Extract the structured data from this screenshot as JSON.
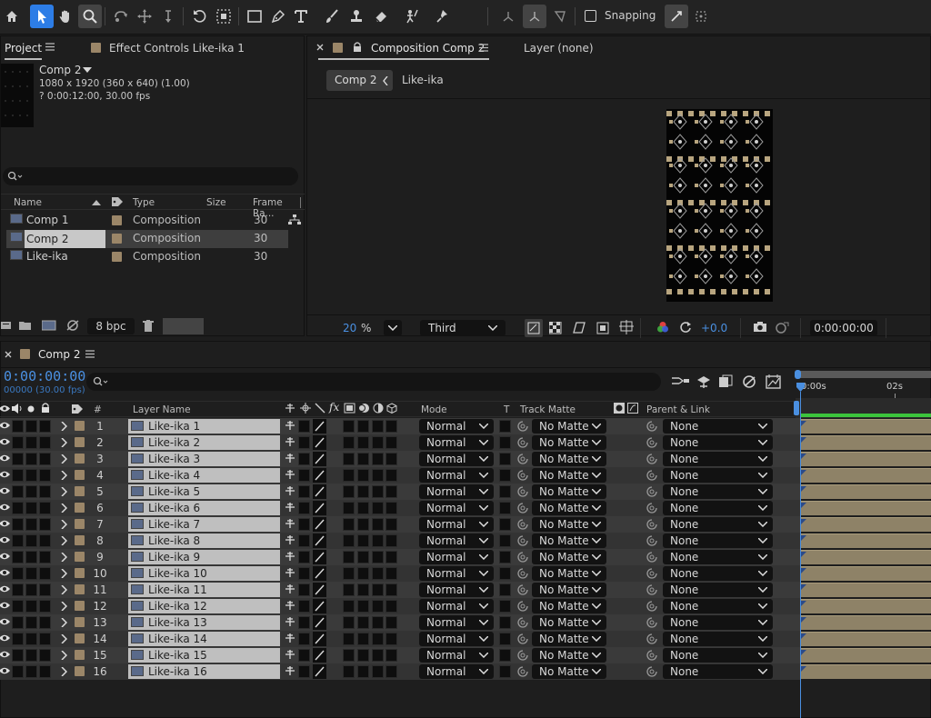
{
  "toolbar": {
    "tools": [
      "home-icon",
      "selection-tool-icon",
      "hand-tool-icon",
      "zoom-tool-icon",
      "rotate-tool-icon",
      "pan-behind-tool-icon",
      "move-tool-icon",
      "undo-icon",
      "region-icon",
      "rectangle-tool-icon",
      "pen-tool-icon",
      "type-tool-icon",
      "brush-tool-icon",
      "clone-stamp-tool-icon",
      "eraser-tool-icon",
      "roto-brush-tool-icon",
      "puppet-pin-tool-icon",
      "axis-local-icon",
      "axis-world-icon",
      "axis-view-icon"
    ],
    "snapping_label": "Snapping"
  },
  "project_panel": {
    "tab_label": "Project",
    "effect_controls_label": "Effect Controls Like-ika 1",
    "comp_name": "Comp 2",
    "comp_info_line1": "1080 x 1920  (360 x 640) (1.00)",
    "comp_info_line2": "? 0:00:12:00, 30.00 fps",
    "search_placeholder": "",
    "columns": {
      "name": "Name",
      "type": "Type",
      "size": "Size",
      "frame_rate": "Frame Ra..."
    },
    "items": [
      {
        "name": "Comp 1",
        "type": "Composition",
        "frame_rate": "30"
      },
      {
        "name": "Comp 2",
        "type": "Composition",
        "frame_rate": "30"
      },
      {
        "name": "Like-ika",
        "type": "Composition",
        "frame_rate": "30"
      }
    ],
    "bpc_label": "8 bpc"
  },
  "viewer": {
    "tab_label": "Composition Comp 2",
    "layer_tab_label": "Layer (none)",
    "breadcrumb_current": "Comp 2",
    "breadcrumb_child": "Like-ika",
    "zoom_value": "20",
    "zoom_unit": "%",
    "resolution": "Third",
    "exposure": "+0.0",
    "timecode": "0:00:00:00"
  },
  "timeline": {
    "tab_label": "Comp 2",
    "current_time": "0:00:00:00",
    "frame_info": "00000 (30.00 fps)",
    "search_placeholder": "",
    "columns": {
      "num": "#",
      "layer_name": "Layer Name",
      "mode": "Mode",
      "t": "T",
      "track_matte": "Track Matte",
      "parent": "Parent & Link"
    },
    "ruler": {
      "start": "0:00s",
      "mark": "02s"
    },
    "layers": [
      {
        "num": "1",
        "name": "Like-ika 1",
        "mode": "Normal",
        "matte": "No Matte",
        "parent": "None"
      },
      {
        "num": "2",
        "name": "Like-ika 2",
        "mode": "Normal",
        "matte": "No Matte",
        "parent": "None"
      },
      {
        "num": "3",
        "name": "Like-ika 3",
        "mode": "Normal",
        "matte": "No Matte",
        "parent": "None"
      },
      {
        "num": "4",
        "name": "Like-ika 4",
        "mode": "Normal",
        "matte": "No Matte",
        "parent": "None"
      },
      {
        "num": "5",
        "name": "Like-ika 5",
        "mode": "Normal",
        "matte": "No Matte",
        "parent": "None"
      },
      {
        "num": "6",
        "name": "Like-ika 6",
        "mode": "Normal",
        "matte": "No Matte",
        "parent": "None"
      },
      {
        "num": "7",
        "name": "Like-ika 7",
        "mode": "Normal",
        "matte": "No Matte",
        "parent": "None"
      },
      {
        "num": "8",
        "name": "Like-ika 8",
        "mode": "Normal",
        "matte": "No Matte",
        "parent": "None"
      },
      {
        "num": "9",
        "name": "Like-ika 9",
        "mode": "Normal",
        "matte": "No Matte",
        "parent": "None"
      },
      {
        "num": "10",
        "name": "Like-ika 10",
        "mode": "Normal",
        "matte": "No Matte",
        "parent": "None"
      },
      {
        "num": "11",
        "name": "Like-ika 11",
        "mode": "Normal",
        "matte": "No Matte",
        "parent": "None"
      },
      {
        "num": "12",
        "name": "Like-ika 12",
        "mode": "Normal",
        "matte": "No Matte",
        "parent": "None"
      },
      {
        "num": "13",
        "name": "Like-ika 13",
        "mode": "Normal",
        "matte": "No Matte",
        "parent": "None"
      },
      {
        "num": "14",
        "name": "Like-ika 14",
        "mode": "Normal",
        "matte": "No Matte",
        "parent": "None"
      },
      {
        "num": "15",
        "name": "Like-ika 15",
        "mode": "Normal",
        "matte": "No Matte",
        "parent": "None"
      },
      {
        "num": "16",
        "name": "Like-ika 16",
        "mode": "Normal",
        "matte": "No Matte",
        "parent": "None"
      }
    ]
  },
  "colors": {
    "accent": "#2d7de6",
    "label_sandstone": "#9b8668",
    "work_area_green": "#3cc43c",
    "playhead": "#4a8fe0"
  }
}
